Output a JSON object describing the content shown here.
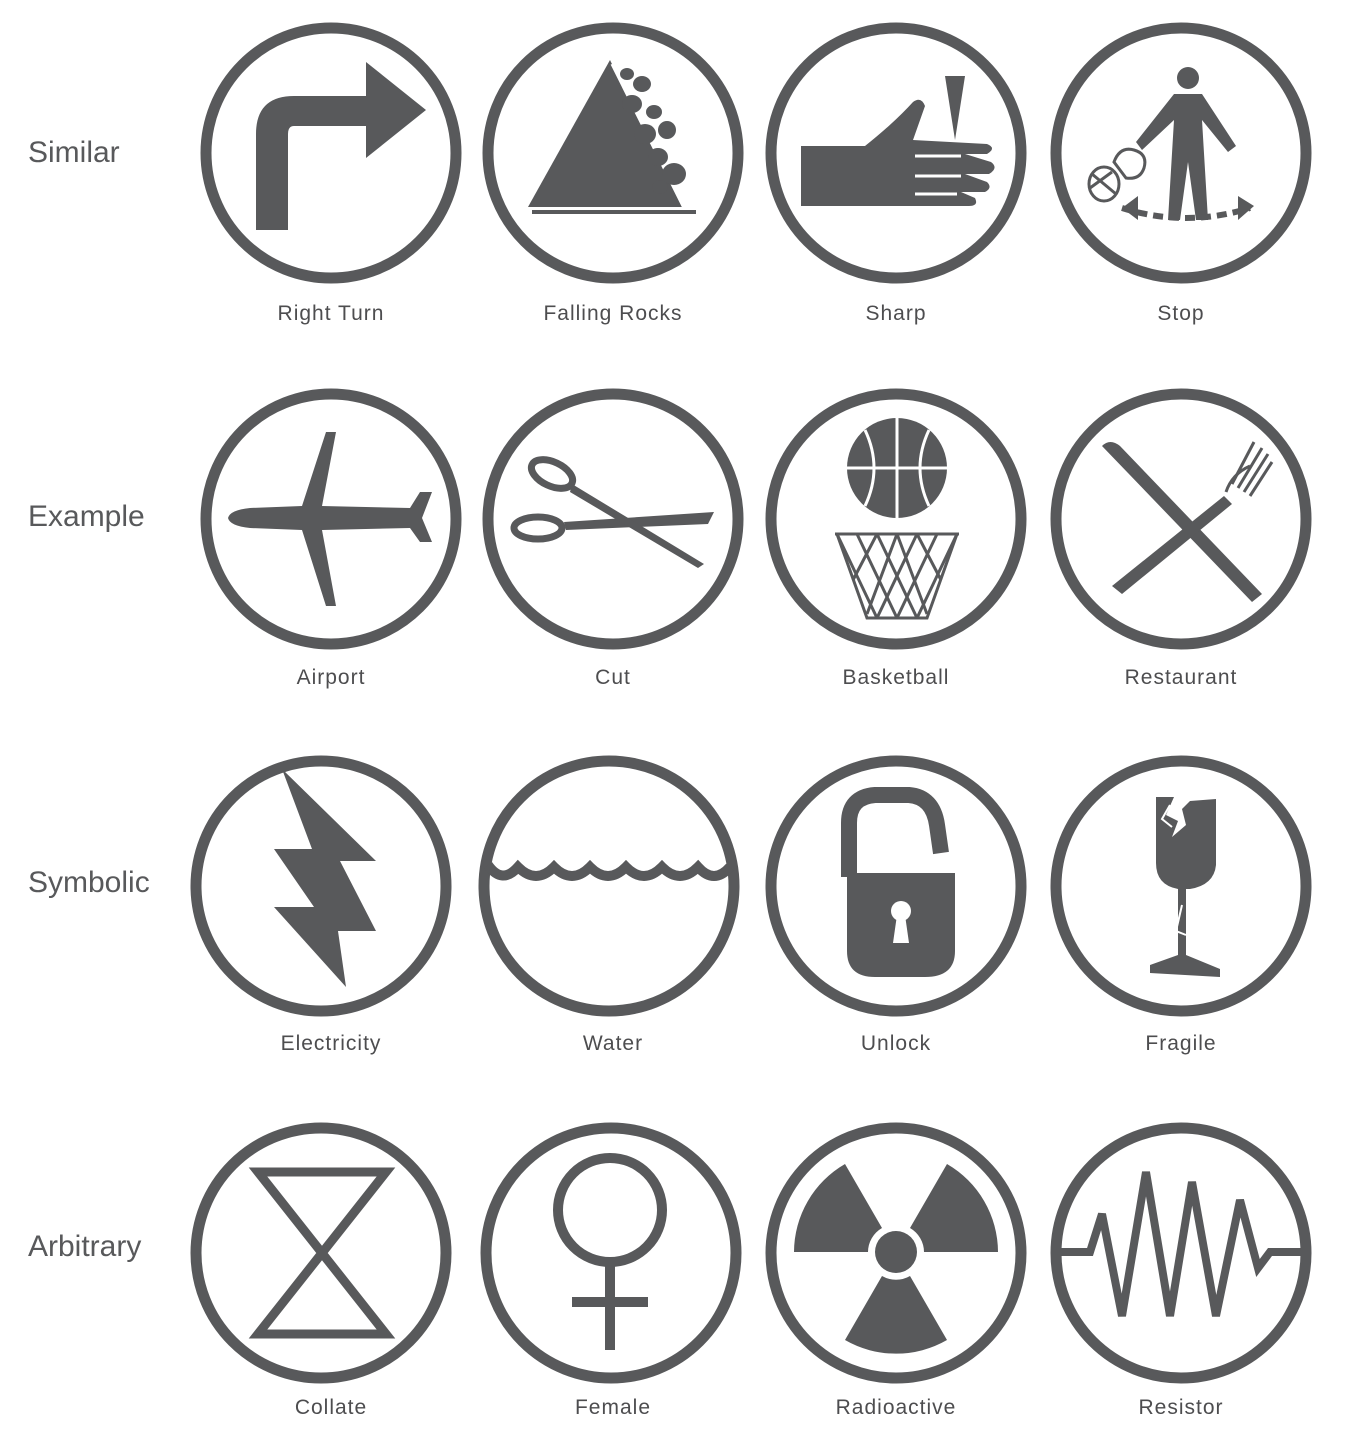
{
  "ink_color": "#58595b",
  "rows": [
    {
      "label": "Similar",
      "signs": [
        {
          "caption": "Right Turn",
          "icon": "right-turn-arrow-icon"
        },
        {
          "caption": "Falling Rocks",
          "icon": "falling-rocks-icon"
        },
        {
          "caption": "Sharp",
          "icon": "sharp-hand-icon"
        },
        {
          "caption": "Stop",
          "icon": "stop-machine-icon"
        }
      ]
    },
    {
      "label": "Example",
      "signs": [
        {
          "caption": "Airport",
          "icon": "airplane-icon"
        },
        {
          "caption": "Cut",
          "icon": "scissors-icon"
        },
        {
          "caption": "Basketball",
          "icon": "basketball-hoop-icon"
        },
        {
          "caption": "Restaurant",
          "icon": "knife-fork-icon"
        }
      ]
    },
    {
      "label": "Symbolic",
      "signs": [
        {
          "caption": "Electricity",
          "icon": "lightning-bolt-icon"
        },
        {
          "caption": "Water",
          "icon": "water-waves-icon"
        },
        {
          "caption": "Unlock",
          "icon": "open-padlock-icon"
        },
        {
          "caption": "Fragile",
          "icon": "broken-glass-icon"
        }
      ]
    },
    {
      "label": "Arbitrary",
      "signs": [
        {
          "caption": "Collate",
          "icon": "hourglass-collate-icon"
        },
        {
          "caption": "Female",
          "icon": "female-symbol-icon"
        },
        {
          "caption": "Radioactive",
          "icon": "radiation-trefoil-icon"
        },
        {
          "caption": "Resistor",
          "icon": "resistor-zigzag-icon"
        }
      ]
    }
  ]
}
